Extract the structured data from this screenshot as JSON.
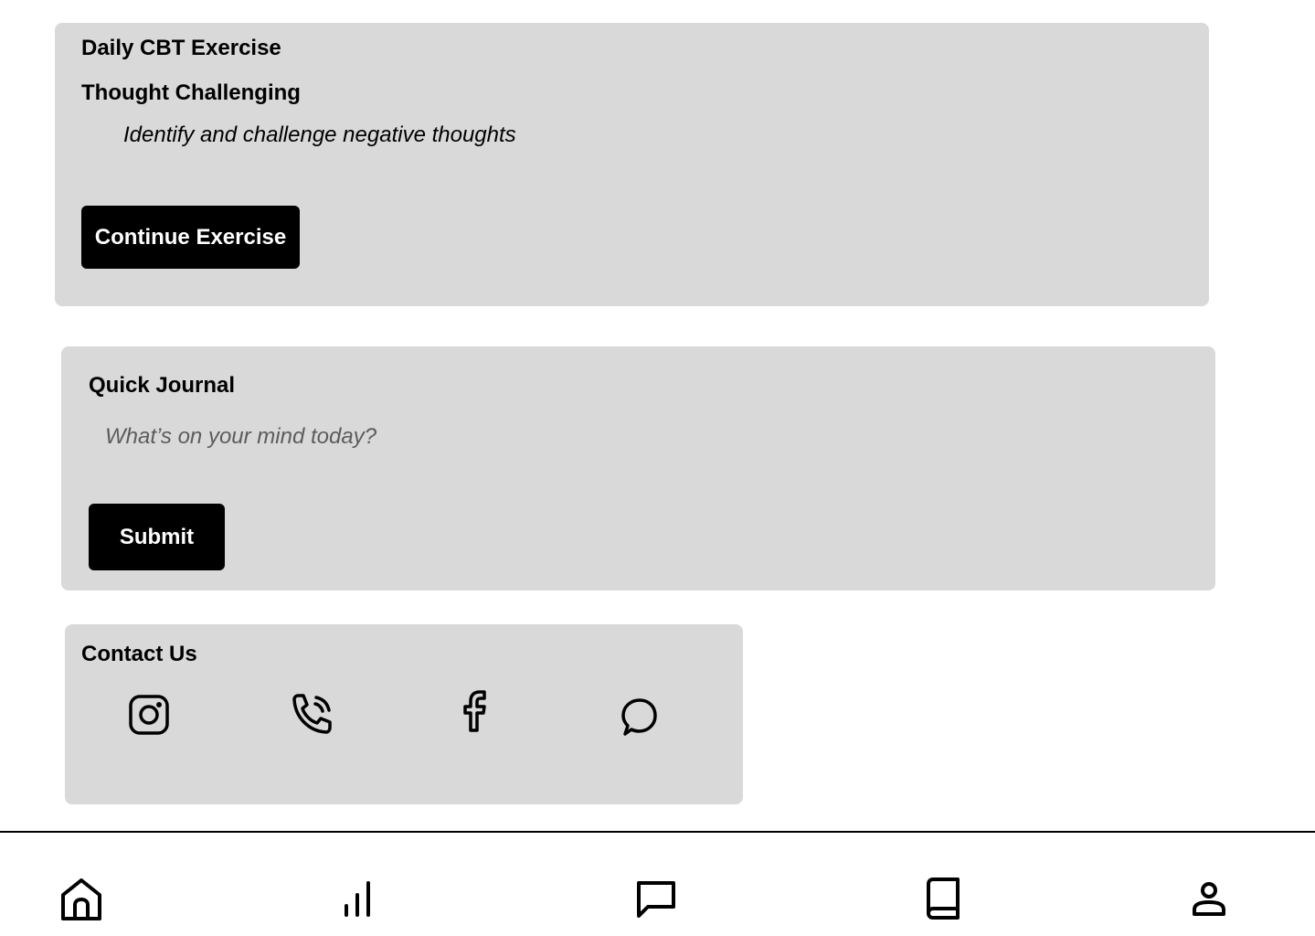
{
  "cbt_card": {
    "title": "Daily CBT Exercise",
    "exercise_name": "Thought Challenging",
    "exercise_description": "Identify and challenge negative thoughts",
    "continue_label": "Continue Exercise"
  },
  "journal_card": {
    "title": "Quick Journal",
    "input_placeholder": "What’s on your mind today?",
    "input_value": "",
    "submit_label": "Submit"
  },
  "contact_card": {
    "title": "Contact Us",
    "icons": [
      "instagram-icon",
      "phone-icon",
      "facebook-icon",
      "chat-icon"
    ]
  },
  "bottom_nav": {
    "items": [
      "home-icon",
      "stats-icon",
      "messages-icon",
      "library-icon",
      "profile-icon"
    ]
  },
  "colors": {
    "card_background": "#d9d9d9",
    "button_background": "#000000",
    "button_text": "#ffffff",
    "divider": "#000000"
  }
}
